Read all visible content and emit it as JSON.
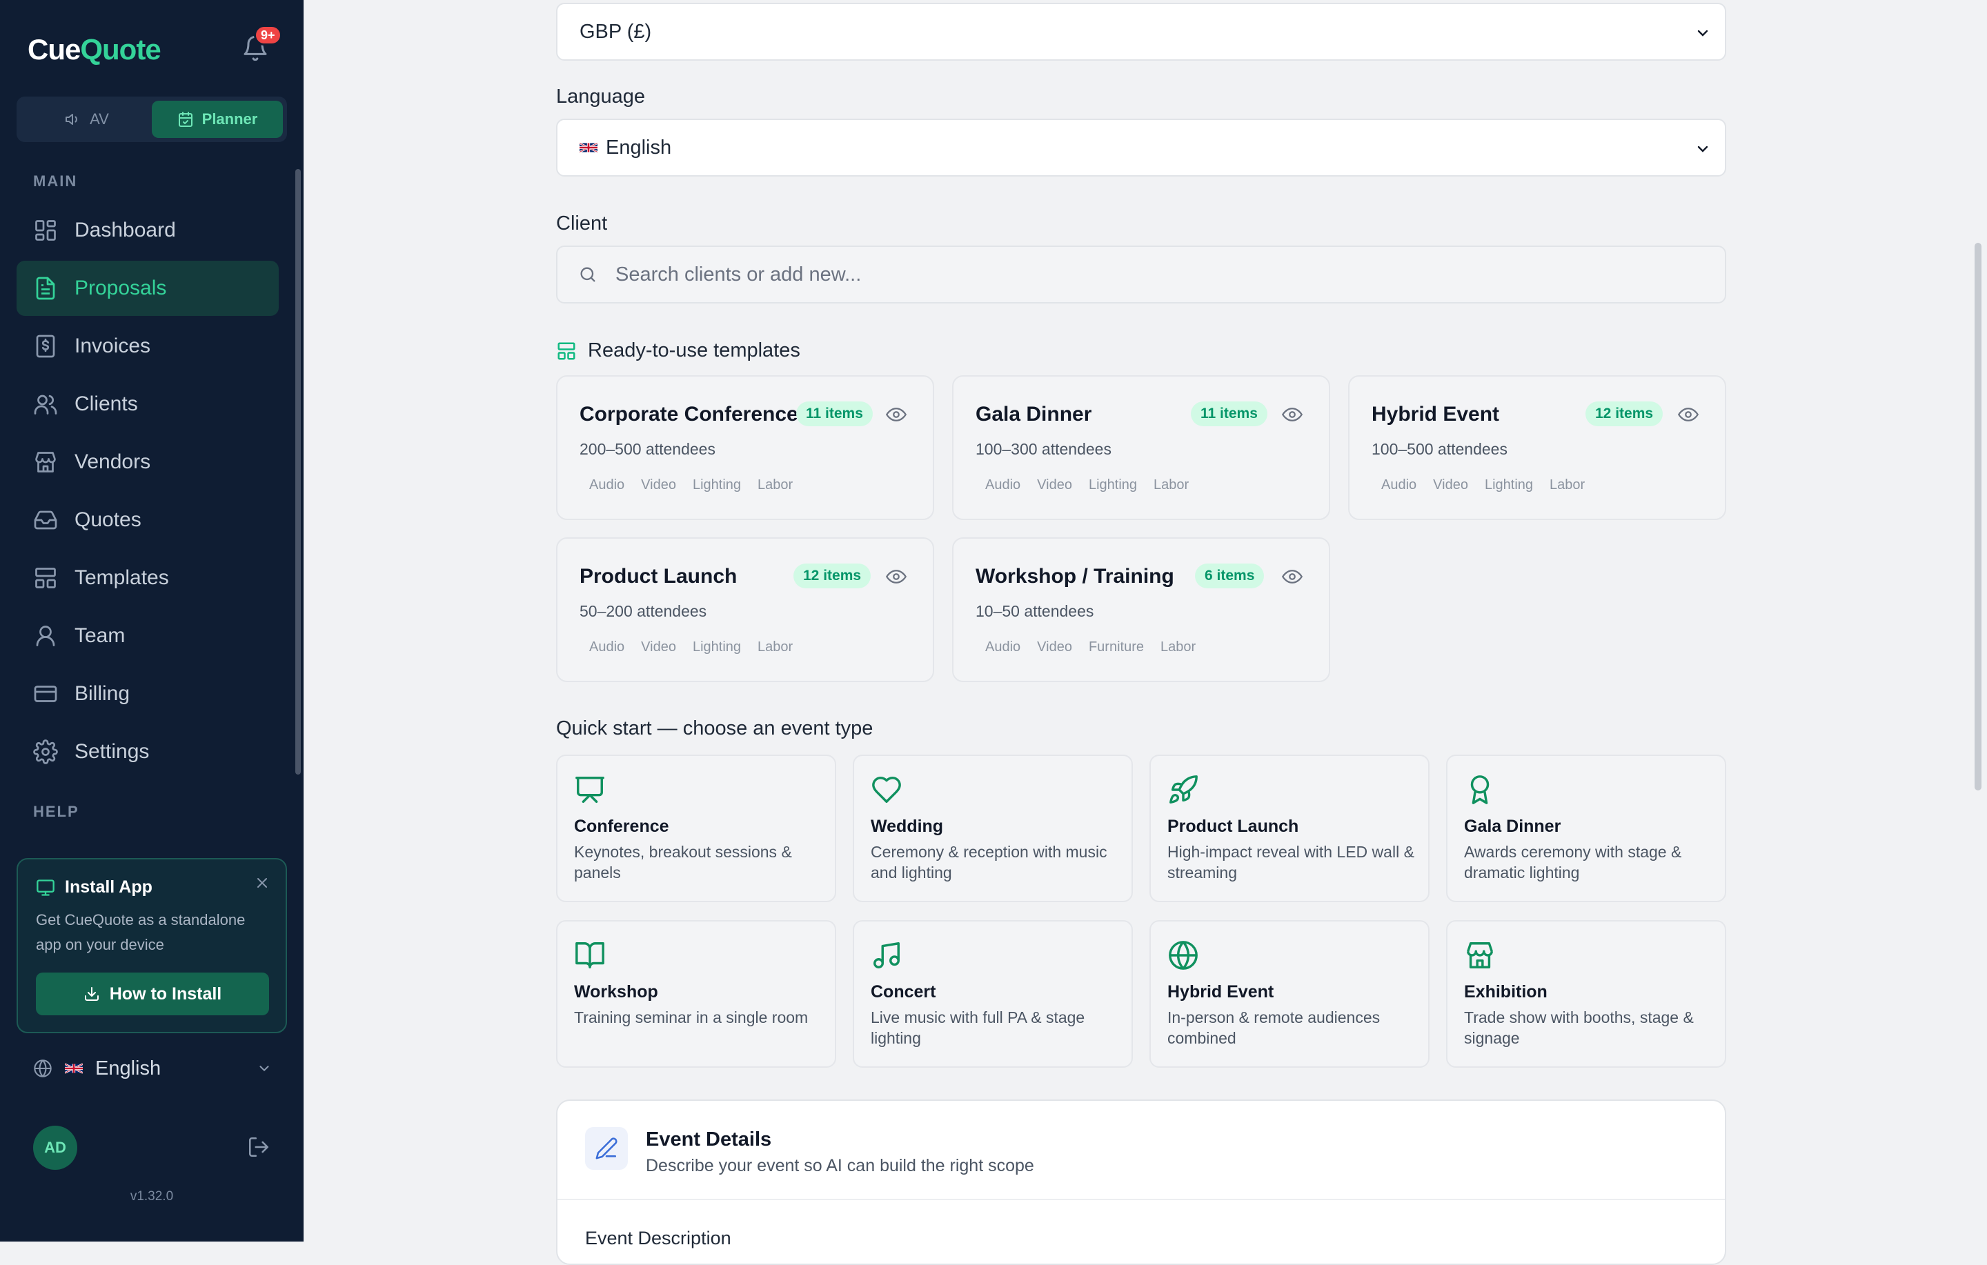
{
  "app": {
    "logo_prefix": "Cue",
    "logo_suffix": "Quote",
    "notifications_badge": "9+"
  },
  "mode_toggle": {
    "av_label": "AV",
    "planner_label": "Planner",
    "active": "Planner"
  },
  "sidebar": {
    "main_label": "MAIN",
    "items": [
      {
        "label": "Dashboard",
        "icon": "grid-icon"
      },
      {
        "label": "Proposals",
        "icon": "file-text-icon",
        "active": true
      },
      {
        "label": "Invoices",
        "icon": "dollar-file-icon"
      },
      {
        "label": "Clients",
        "icon": "users-icon"
      },
      {
        "label": "Vendors",
        "icon": "store-icon"
      },
      {
        "label": "Quotes",
        "icon": "inbox-icon"
      },
      {
        "label": "Templates",
        "icon": "layout-icon"
      },
      {
        "label": "Team",
        "icon": "user-icon"
      },
      {
        "label": "Billing",
        "icon": "credit-card-icon"
      },
      {
        "label": "Settings",
        "icon": "gear-icon"
      }
    ],
    "help_label": "HELP",
    "install": {
      "title": "Install App",
      "text": "Get CueQuote as a standalone app on your device",
      "button": "How to Install"
    },
    "language": "English",
    "avatar_initials": "AD",
    "version": "v1.32.0"
  },
  "form": {
    "currency_value": "GBP (£)",
    "language_label": "Language",
    "language_value": "English",
    "client_label": "Client",
    "client_placeholder": "Search clients or add new...",
    "templates_heading": "Ready-to-use templates",
    "quickstart_heading": "Quick start — choose an event type"
  },
  "templates": [
    {
      "name": "Corporate Conference",
      "badge": "11 items",
      "attendees": "200–500 attendees",
      "tags": [
        "Audio",
        "Video",
        "Lighting",
        "Labor"
      ]
    },
    {
      "name": "Gala Dinner",
      "badge": "11 items",
      "attendees": "100–300 attendees",
      "tags": [
        "Audio",
        "Video",
        "Lighting",
        "Labor"
      ]
    },
    {
      "name": "Hybrid Event",
      "badge": "12 items",
      "attendees": "100–500 attendees",
      "tags": [
        "Audio",
        "Video",
        "Lighting",
        "Labor"
      ]
    },
    {
      "name": "Product Launch",
      "badge": "12 items",
      "attendees": "50–200 attendees",
      "tags": [
        "Audio",
        "Video",
        "Lighting",
        "Labor"
      ]
    },
    {
      "name": "Workshop / Training",
      "badge": "6 items",
      "attendees": "10–50 attendees",
      "tags": [
        "Audio",
        "Video",
        "Furniture",
        "Labor"
      ]
    }
  ],
  "event_types": [
    {
      "name": "Conference",
      "desc": "Keynotes, breakout sessions & panels",
      "icon": "presentation-icon"
    },
    {
      "name": "Wedding",
      "desc": "Ceremony & reception with music and lighting",
      "icon": "heart-icon"
    },
    {
      "name": "Product Launch",
      "desc": "High-impact reveal with LED wall & streaming",
      "icon": "rocket-icon"
    },
    {
      "name": "Gala Dinner",
      "desc": "Awards ceremony with stage & dramatic lighting",
      "icon": "award-icon"
    },
    {
      "name": "Workshop",
      "desc": "Training seminar in a single room",
      "icon": "book-open-icon"
    },
    {
      "name": "Concert",
      "desc": "Live music with full PA & stage lighting",
      "icon": "music-icon"
    },
    {
      "name": "Hybrid Event",
      "desc": "In-person & remote audiences combined",
      "icon": "globe-icon"
    },
    {
      "name": "Exhibition",
      "desc": "Trade show with booths, stage & signage",
      "icon": "store-icon"
    }
  ],
  "event_details": {
    "title": "Event Details",
    "subtitle": "Describe your event so AI can build the right scope",
    "next_label": "Event Description"
  },
  "colors": {
    "sidebar_bg": "#0f1d33",
    "accent": "#34d399",
    "accent_dark": "#14654f",
    "badge_bg": "#d1fae5",
    "badge_text": "#059669"
  }
}
